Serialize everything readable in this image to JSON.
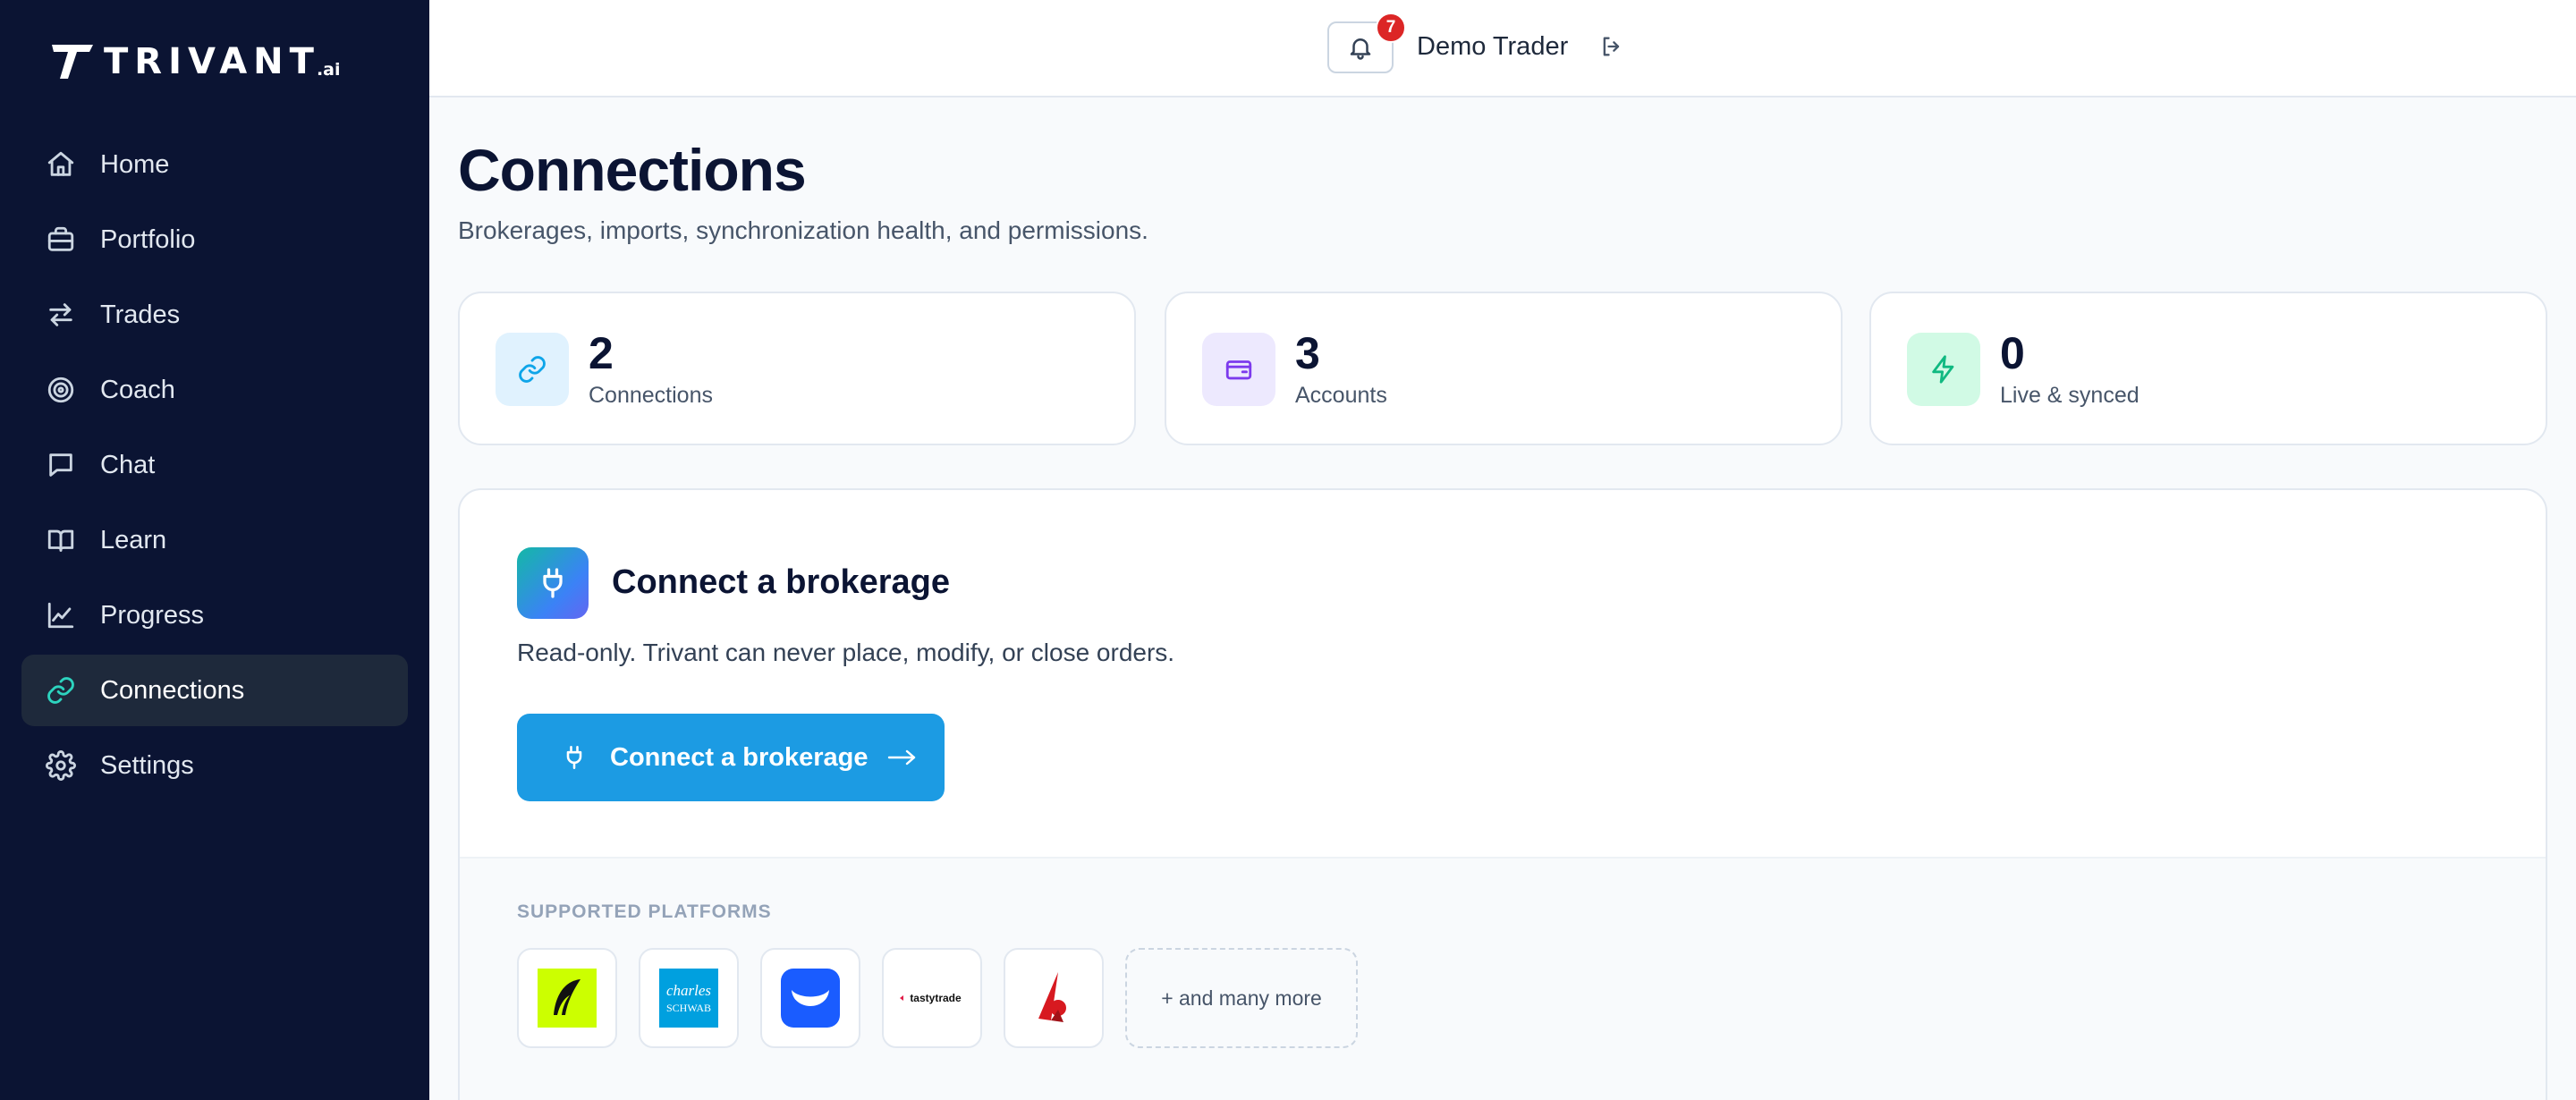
{
  "brand": {
    "name": "TRIVANT",
    "suffix": ".ai"
  },
  "sidebar": {
    "items": [
      {
        "label": "Home",
        "icon": "home-icon"
      },
      {
        "label": "Portfolio",
        "icon": "briefcase-icon"
      },
      {
        "label": "Trades",
        "icon": "arrows-exchange-icon"
      },
      {
        "label": "Coach",
        "icon": "target-icon"
      },
      {
        "label": "Chat",
        "icon": "chat-icon"
      },
      {
        "label": "Learn",
        "icon": "book-icon"
      },
      {
        "label": "Progress",
        "icon": "line-chart-icon"
      },
      {
        "label": "Connections",
        "icon": "link-icon",
        "active": true
      },
      {
        "label": "Settings",
        "icon": "gear-icon"
      }
    ]
  },
  "topbar": {
    "notifications_count": "7",
    "user_name": "Demo Trader"
  },
  "page": {
    "title": "Connections",
    "subtitle": "Brokerages, imports, synchronization health, and permissions."
  },
  "stats": [
    {
      "value": "2",
      "label": "Connections",
      "icon": "link-icon",
      "color": "#0ea5e9"
    },
    {
      "value": "3",
      "label": "Accounts",
      "icon": "wallet-icon",
      "color": "#7c3aed"
    },
    {
      "value": "0",
      "label": "Live & synced",
      "icon": "lightning-icon",
      "color": "#10b981"
    }
  ],
  "connect": {
    "title": "Connect a brokerage",
    "description": "Read-only. Trivant can never place, modify, or close orders.",
    "button_label": "Connect a brokerage"
  },
  "platforms": {
    "label": "SUPPORTED PLATFORMS",
    "items": [
      {
        "name": "Robinhood",
        "icon": "robinhood-feather-logo"
      },
      {
        "name": "Charles Schwab",
        "logo_text": "charles SCHWAB"
      },
      {
        "name": "Webull",
        "icon": "webull-logo"
      },
      {
        "name": "tastytrade",
        "logo_text": "tastytrade"
      },
      {
        "name": "Interactive Brokers",
        "icon": "ibkr-logo"
      }
    ],
    "more_label": "+ and many more"
  },
  "colors": {
    "sidebar_bg": "#0b1433",
    "accent": "#1c9be3",
    "active_icon": "#2dd4bf",
    "badge": "#dc2626"
  }
}
